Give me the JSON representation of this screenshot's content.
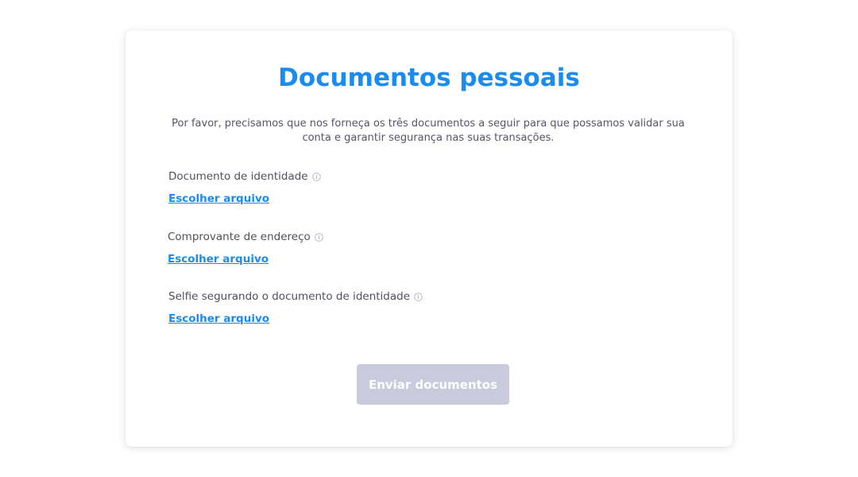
{
  "page": {
    "title": "Documentos pessoais",
    "intro": "Por favor, precisamos que nos forneça os três documentos a seguir para que possamos validar sua conta e garantir segurança nas suas transações."
  },
  "documents": [
    {
      "label": "Documento de identidade",
      "action": "Escolher arquivo"
    },
    {
      "label": "Comprovante de endereço",
      "action": "Escolher arquivo"
    },
    {
      "label": "Selfie segurando o documento de identidade",
      "action": "Escolher arquivo"
    }
  ],
  "submit": {
    "label": "Enviar documentos",
    "state": "disabled"
  },
  "icons": {
    "info": "info-circle-icon"
  },
  "colors": {
    "accent": "#1a8cf0",
    "text": "#555566",
    "button_disabled_bg": "#c9cbdc"
  }
}
